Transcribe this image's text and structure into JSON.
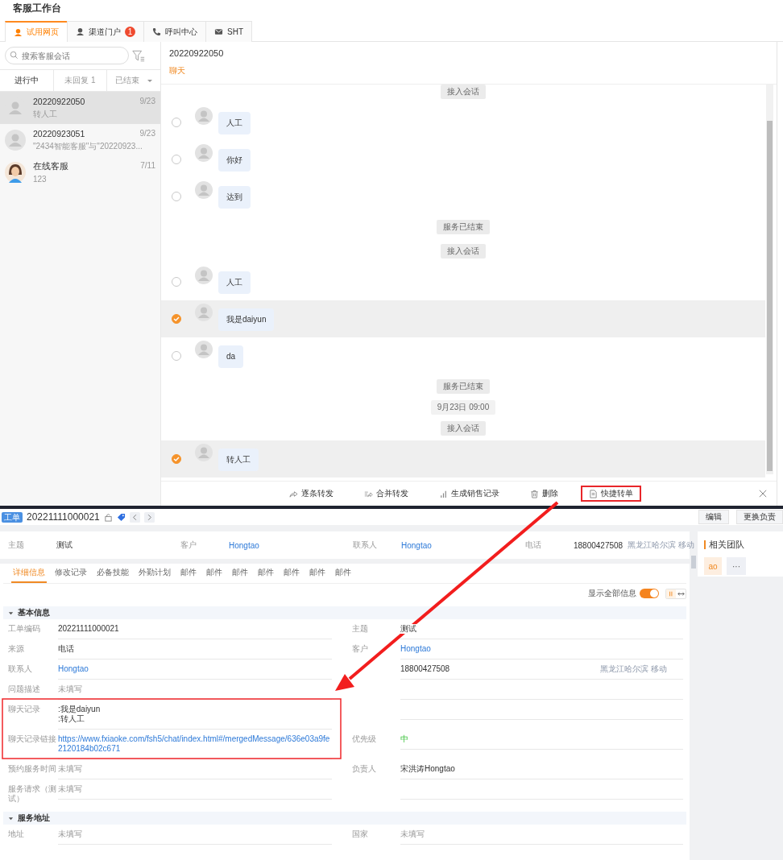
{
  "app_title": "客服工作台",
  "channel_tabs": [
    {
      "label": "试用网页",
      "selected": true
    },
    {
      "label": "渠道门户",
      "badge": "1",
      "selected": false
    },
    {
      "label": "呼叫中心",
      "selected": false
    },
    {
      "label": "SHT",
      "selected": false
    }
  ],
  "search": {
    "placeholder": "搜索客服会话"
  },
  "filter_tabs": [
    {
      "label": "进行中",
      "selected": true
    },
    {
      "label": "未回复 1",
      "selected": false
    },
    {
      "label": "已结束",
      "selected": false,
      "dropdown": true
    }
  ],
  "conversations": [
    {
      "kind": "visitor",
      "name": "20220922050",
      "preview": "转人工",
      "date": "9/23",
      "selected": true
    },
    {
      "kind": "visitor",
      "name": "20220923051",
      "preview": "\"2434智能客服\"与\"20220923...",
      "date": "9/23",
      "selected": false
    },
    {
      "kind": "agent",
      "name": "在线客服",
      "preview": "123",
      "date": "7/11",
      "selected": false
    }
  ],
  "chat": {
    "title": "20220922050",
    "tab": "聊天",
    "messages": [
      {
        "kind": "system",
        "text": "接入会话"
      },
      {
        "kind": "message",
        "text": "人工",
        "selected": false
      },
      {
        "kind": "message",
        "text": "你好",
        "selected": false
      },
      {
        "kind": "message",
        "text": "达到",
        "selected": false
      },
      {
        "kind": "system",
        "text": "服务已结束"
      },
      {
        "kind": "system",
        "text": "接入会话"
      },
      {
        "kind": "message",
        "text": "人工",
        "selected": false
      },
      {
        "kind": "message",
        "text": "我是daiyun",
        "selected": true
      },
      {
        "kind": "message",
        "text": "da",
        "selected": false
      },
      {
        "kind": "system",
        "text": "服务已结束"
      },
      {
        "kind": "time",
        "text": "9月23日 09:00"
      },
      {
        "kind": "system",
        "text": "接入会话"
      },
      {
        "kind": "message",
        "text": "转人工",
        "selected": true
      }
    ],
    "actions": [
      {
        "label": "逐条转发",
        "annotated": false
      },
      {
        "label": "合并转发",
        "annotated": false
      },
      {
        "label": "生成销售记录",
        "annotated": false
      },
      {
        "label": "删除",
        "annotated": false
      },
      {
        "label": "快捷转单",
        "annotated": true
      }
    ]
  },
  "ticket": {
    "tag": "工单",
    "number": "20221111000021",
    "buttons": [
      "编辑",
      "更换负责"
    ],
    "summary": [
      {
        "label": "主题",
        "value": "测试",
        "kind": "text"
      },
      {
        "label": "客户",
        "value": "Hongtao",
        "kind": "link"
      },
      {
        "label": "联系人",
        "value": "Hongtao",
        "kind": "link"
      },
      {
        "label": "电话",
        "value": "18800427508",
        "kind": "text",
        "note": "黑龙江哈尔滨 移动"
      }
    ],
    "tabs": [
      {
        "label": "详细信息",
        "selected": true
      },
      {
        "label": "修改记录",
        "selected": false
      },
      {
        "label": "必备技能",
        "selected": false
      },
      {
        "label": "外勤计划",
        "selected": false
      },
      {
        "label": "邮件",
        "selected": false
      },
      {
        "label": "邮件",
        "selected": false
      },
      {
        "label": "邮件",
        "selected": false
      },
      {
        "label": "邮件",
        "selected": false
      },
      {
        "label": "邮件",
        "selected": false
      },
      {
        "label": "邮件",
        "selected": false
      },
      {
        "label": "邮件",
        "selected": false
      }
    ],
    "show_all": {
      "label": "显示全部信息",
      "on": true
    },
    "sections": [
      {
        "title": "基本信息",
        "expanded": true,
        "rows": [
          {
            "cells": [
              {
                "label": "工单编码",
                "value": "20221111000021",
                "kind": "text"
              },
              {
                "label": "主题",
                "value": "测试",
                "kind": "text"
              }
            ]
          },
          {
            "cells": [
              {
                "label": "来源",
                "value": "电话",
                "kind": "text"
              },
              {
                "label": "客户",
                "value": "Hongtao",
                "kind": "link"
              }
            ]
          },
          {
            "cells": [
              {
                "label": "联系人",
                "value": "Hongtao",
                "kind": "link"
              },
              {
                "value": "18800427508",
                "kind": "text",
                "note": "黑龙江哈尔滨 移动"
              }
            ]
          },
          {
            "cells": [
              {
                "label": "问题描述",
                "value": "未填写",
                "kind": "empty"
              },
              {
                "kind": "blank"
              }
            ]
          },
          {
            "cells": [
              {
                "label": "聊天记录",
                "lines": [
                  ":我是daiyun",
                  ":转人工"
                ],
                "kind": "lines"
              },
              {
                "kind": "blank"
              }
            ]
          },
          {
            "cells": [
              {
                "label": "聊天记录链接",
                "value": "https://www.fxiaoke.com/fsh5/chat/index.html#/mergedMessage/636e03a9fe2120184b02c671",
                "kind": "link"
              },
              {
                "label": "优先级",
                "value": "中",
                "kind": "priority"
              }
            ]
          },
          {
            "cells": [
              {
                "label": "预约服务时间",
                "value": "未填写",
                "kind": "empty"
              },
              {
                "label": "负责人",
                "value": "宋洪涛Hongtao",
                "kind": "text"
              }
            ]
          },
          {
            "cells": [
              {
                "label": "服务请求（测试）",
                "value": "未填写",
                "kind": "empty"
              },
              {
                "kind": "blank"
              }
            ]
          }
        ]
      },
      {
        "title": "服务地址",
        "expanded": true,
        "rows": [
          {
            "cells": [
              {
                "label": "地址",
                "value": "未填写",
                "kind": "empty"
              },
              {
                "label": "国家",
                "value": "未填写",
                "kind": "empty"
              }
            ]
          }
        ]
      }
    ]
  },
  "team": {
    "title": "相关团队",
    "member": "ao",
    "more": "···"
  }
}
